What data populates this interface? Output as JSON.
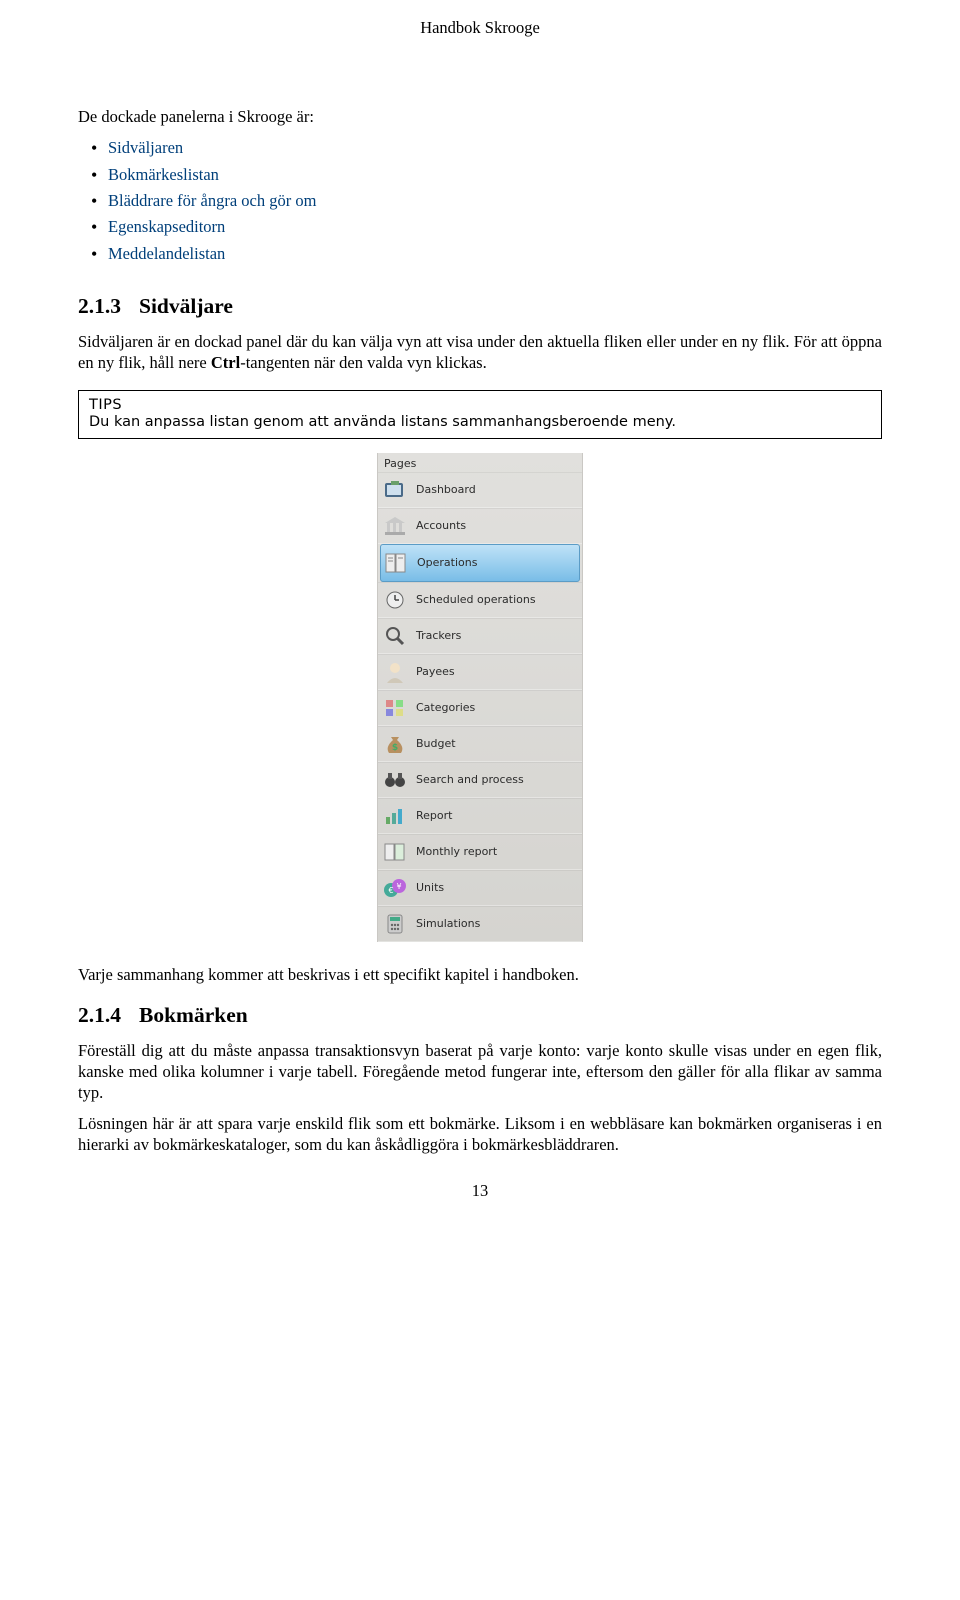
{
  "header": {
    "title": "Handbok Skrooge"
  },
  "intro": {
    "text": "De dockade panelerna i Skrooge är:"
  },
  "panel_list": [
    {
      "label": "Sidväljaren"
    },
    {
      "label": "Bokmärkeslistan"
    },
    {
      "label": "Bläddrare för ångra och gör om"
    },
    {
      "label": "Egenskapseditorn"
    },
    {
      "label": "Meddelandelistan"
    }
  ],
  "section_213": {
    "num": "2.1.3",
    "title": "Sidväljare",
    "para_1a": "Sidväljaren är en dockad panel där du kan välja vyn att visa under den aktuella fliken eller under en ny flik. För att öppna en ny flik, håll nere ",
    "para_1_ctrl": "Ctrl",
    "para_1b": "-tangenten när den valda vyn klickas."
  },
  "tips": {
    "title": "TIPS",
    "body": "Du kan anpassa listan genom att använda listans sammanhangsberoende meny."
  },
  "screenshot": {
    "header": "Pages",
    "items": [
      {
        "label": "Dashboard",
        "selected": false
      },
      {
        "label": "Accounts",
        "selected": false
      },
      {
        "label": "Operations",
        "selected": true
      },
      {
        "label": "Scheduled operations",
        "selected": false
      },
      {
        "label": "Trackers",
        "selected": false
      },
      {
        "label": "Payees",
        "selected": false
      },
      {
        "label": "Categories",
        "selected": false
      },
      {
        "label": "Budget",
        "selected": false
      },
      {
        "label": "Search and process",
        "selected": false
      },
      {
        "label": "Report",
        "selected": false
      },
      {
        "label": "Monthly report",
        "selected": false
      },
      {
        "label": "Units",
        "selected": false
      },
      {
        "label": "Simulations",
        "selected": false
      }
    ]
  },
  "after_screenshot": {
    "text": "Varje sammanhang kommer att beskrivas i ett specifikt kapitel i handboken."
  },
  "section_214": {
    "num": "2.1.4",
    "title": "Bokmärken",
    "para_1": "Föreställ dig att du måste anpassa transaktionsvyn baserat på varje konto: varje konto skulle visas under en egen flik, kanske med olika kolumner i varje tabell. Föregående metod fungerar inte, eftersom den gäller för alla flikar av samma typ.",
    "para_2": "Lösningen här är att spara varje enskild flik som ett bokmärke. Liksom i en webbläsare kan bokmärken organiseras i en hierarki av bokmärkeskataloger, som du kan åskådliggöra i bokmärkesbläddraren."
  },
  "page_number": "13"
}
